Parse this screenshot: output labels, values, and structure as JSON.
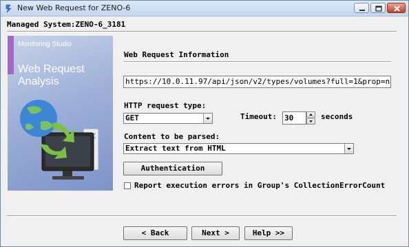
{
  "window": {
    "title": "New Web Request for ZENO-6"
  },
  "header": {
    "managed_system": "Managed System:ZENO-6_3181"
  },
  "banner": {
    "product": "Monitoring Studio",
    "heading_line1": "Web Request",
    "heading_line2": "Analysis"
  },
  "section": {
    "title": "Web Request Information"
  },
  "form": {
    "url_value": "https://10.0.11.97/api/json/v2/types/volumes?full=1&prop=nam",
    "http_type_label": "HTTP request type:",
    "http_type_value": "GET",
    "timeout_label": "Timeout:",
    "timeout_value": "30",
    "timeout_unit": "seconds",
    "content_label": "Content to be parsed:",
    "content_value": "Extract text from HTML",
    "auth_button": "Authentication",
    "report_errors_label": "Report execution errors in Group's CollectionErrorCount",
    "report_errors_checked": false
  },
  "footer": {
    "back": "< Back",
    "next": "Next >",
    "help": "Help >>"
  },
  "colors": {
    "banner_accent": "#a565c9",
    "banner_bg": "#9eb0d8",
    "close_button": "#c1432c"
  }
}
